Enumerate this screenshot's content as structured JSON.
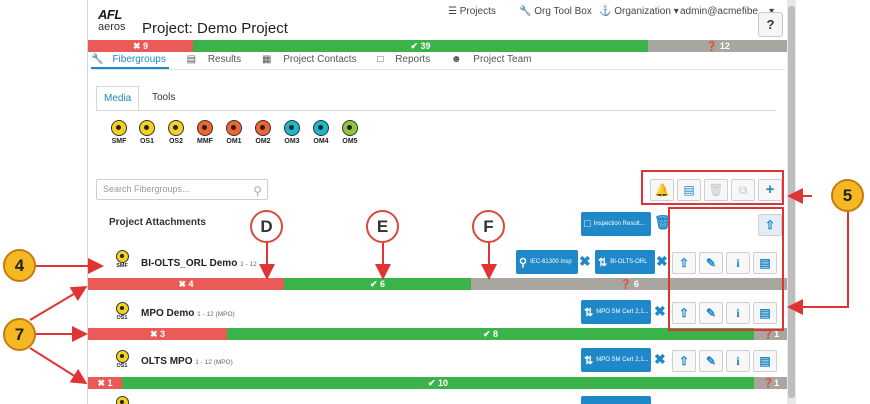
{
  "header": {
    "logo_top": "AFL",
    "logo_bottom": "aeros",
    "project_title": "Project: Demo Project",
    "nav_projects": "Projects",
    "nav_org_tool_box": "Org Tool Box",
    "nav_organization": "Organization",
    "nav_user": "admin@acmefibe...",
    "help": "?"
  },
  "project_summary": {
    "fail": "9",
    "pass": "39",
    "pending": "12",
    "fail_frac": 0.15,
    "pass_frac": 0.65,
    "pending_frac": 0.2
  },
  "main_tabs": [
    "Fibergroups",
    "Results",
    "Project Contacts",
    "Reports",
    "Project Team"
  ],
  "sub_tabs": [
    "Media",
    "Tools"
  ],
  "media": [
    {
      "label": "SMF",
      "color": "#f3d21f"
    },
    {
      "label": "OS1",
      "color": "#f3d21f"
    },
    {
      "label": "OS2",
      "color": "#f3d21f"
    },
    {
      "label": "MMF",
      "color": "#f0652f"
    },
    {
      "label": "OM1",
      "color": "#f0652f"
    },
    {
      "label": "OM2",
      "color": "#f0652f"
    },
    {
      "label": "OM3",
      "color": "#19b9c7"
    },
    {
      "label": "OM4",
      "color": "#19b9c7"
    },
    {
      "label": "OM5",
      "color": "#8fc63f"
    }
  ],
  "search": {
    "placeholder": "Search Fibergroups..."
  },
  "attachments": {
    "title": "Project Attachments",
    "button_label": "Inspection Result..."
  },
  "rows": [
    {
      "name": "BI-OLTS_ORL Demo",
      "range": "1 - 12",
      "media": "SMF",
      "tool1": "IEC-61300 Insp",
      "tool2": "BI-OLTS-ORL",
      "fail": "4",
      "pass": "6",
      "pending": "6",
      "fail_frac": 0.3,
      "pass_frac": 0.29,
      "pending_frac": 0.41
    },
    {
      "name": "MPO Demo",
      "range": "1 - 12 (MPO)",
      "media": "OS1",
      "tool2": "MPO SM Cert 2,1...",
      "fail": "3",
      "pass": "8",
      "pending": "1",
      "fail_frac": 0.19,
      "pass_frac": 0.77,
      "pending_frac": 0.04
    },
    {
      "name": "OLTS MPO",
      "range": "1 - 12 (MPO)",
      "media": "OS1",
      "tool2": "MPO SM Cert 2,1...",
      "fail": "1",
      "pass": "10",
      "pending": "1",
      "fail_frac": 0.05,
      "pass_frac": 0.91,
      "pending_frac": 0.04
    }
  ],
  "callouts": {
    "d": "D",
    "e": "E",
    "f": "F",
    "four": "4",
    "five": "5",
    "seven": "7"
  },
  "colors": {
    "accent": "#1e88c8",
    "fail": "#ea5b57",
    "pass": "#3ab34a",
    "pending": "#a9a59f",
    "annotation": "#e03434",
    "callout_orange": "#f5b823"
  }
}
